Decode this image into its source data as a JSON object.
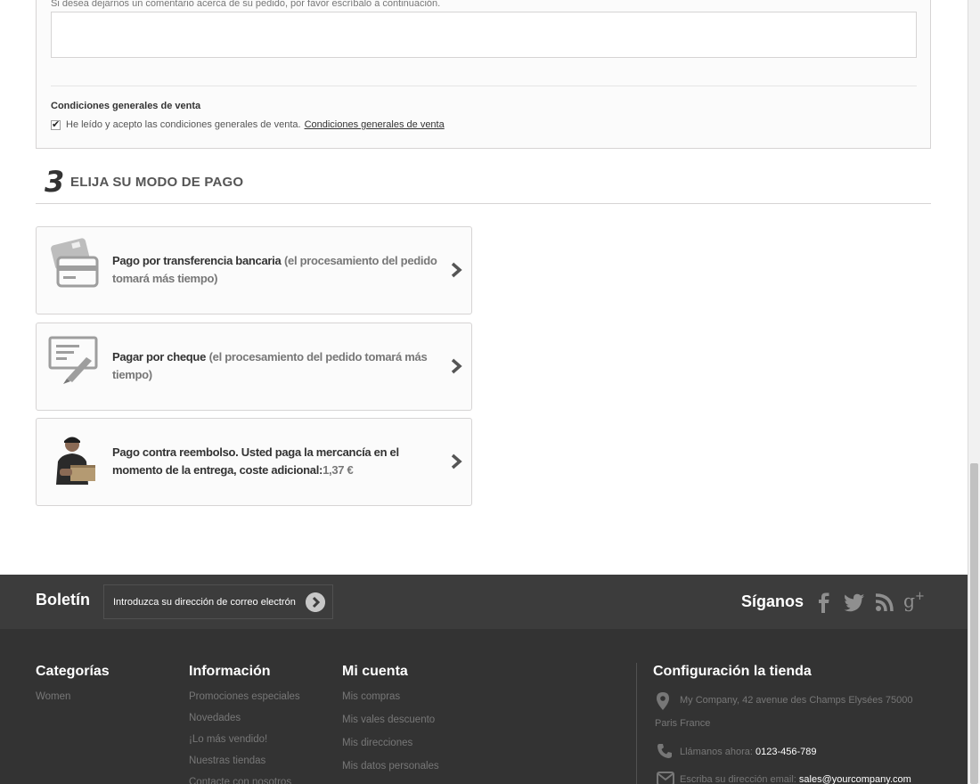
{
  "order": {
    "comment_hint": "Si desea dejarnos un comentario acerca de su pedido, por favor escríbalo a continuación.",
    "terms_title": "Condiciones generales de venta",
    "terms_text": "He leído y acepto las condiciones generales de venta.",
    "terms_link": "Condiciones generales de venta"
  },
  "step3": {
    "number": "3",
    "title": "ELIJA SU MODO DE PAGO"
  },
  "payments": [
    {
      "icon": "bank-card-icon",
      "title": "Pago por transferencia bancaria",
      "note": "(el procesamiento del pedido tomará más tiempo)"
    },
    {
      "icon": "cheque-icon",
      "title": "Pagar por cheque",
      "note": "(el procesamiento del pedido tomará más tiempo)"
    },
    {
      "icon": "delivery-man-icon",
      "title": "Pago contra reembolso. Usted paga la mercancía en el momento de la entrega, coste adicional:",
      "note": "1,37 €"
    }
  ],
  "newsletter": {
    "title": "Boletín",
    "placeholder": "Introduzca su dirección de correo electrón",
    "follow_title": "Síganos",
    "social": [
      "facebook-icon",
      "twitter-icon",
      "rss-icon",
      "google-plus-icon"
    ]
  },
  "footer": {
    "categories": {
      "title": "Categorías",
      "items": [
        "Women"
      ]
    },
    "information": {
      "title": "Información",
      "items": [
        "Promociones especiales",
        "Novedades",
        "¡Lo más vendido!",
        "Nuestras tiendas",
        "Contacte con nosotros"
      ]
    },
    "account": {
      "title": "Mi cuenta",
      "items": [
        "Mis compras",
        "Mis vales descuento",
        "Mis direcciones",
        "Mis datos personales"
      ]
    },
    "store": {
      "title": "Configuración la tienda",
      "address_line1": "My Company, 42 avenue des Champs Elysées 75000",
      "address_line2": "Paris France",
      "phone_label": "Llámanos ahora:",
      "phone": "0123-456-789",
      "email_label": "Escriba su dirección email:",
      "email": "sales@yourcompany.com"
    }
  }
}
